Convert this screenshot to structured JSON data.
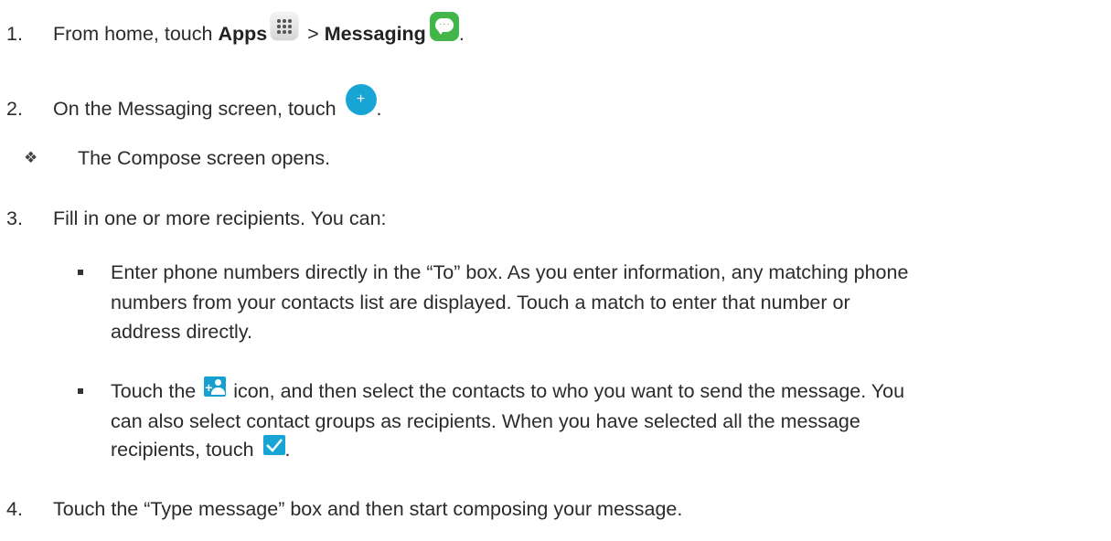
{
  "step1": {
    "number": "1.",
    "prefix": "From home, touch ",
    "apps": "Apps",
    "separator": " > ",
    "messaging": "Messaging",
    "suffix": ".",
    "icons": [
      "apps-grid-icon",
      "messaging-app-icon"
    ]
  },
  "step2": {
    "number": "2.",
    "text": "On the Messaging screen, touch ",
    "suffix": ".",
    "icon": "plus-circle-icon",
    "note_symbol": "❖",
    "note": "The Compose screen opens."
  },
  "step3": {
    "number": "3.",
    "text": "Fill in one or more recipients. You can:",
    "bullet1": [
      "Enter phone numbers directly in the “To” box. As you enter information, any matching phone",
      "numbers from your contacts list are displayed. Touch a match to enter that number or",
      "address directly."
    ],
    "bullet2": {
      "line1_prefix": "Touch the ",
      "line1_suffix": " icon, and then select the contacts to who you want to send the message. You",
      "line2": "can also select contact groups as recipients. When you have selected all the message",
      "line3_prefix": "recipients, touch ",
      "line3_suffix": ".",
      "icons": [
        "add-contact-icon",
        "checkmark-icon"
      ]
    }
  },
  "step4": {
    "number": "4.",
    "text": "Touch the “Type message” box and then start composing your message."
  },
  "colors": {
    "text": "#2b2b2b",
    "accent_blue": "#17a5d6",
    "messaging_green": "#43b649"
  }
}
